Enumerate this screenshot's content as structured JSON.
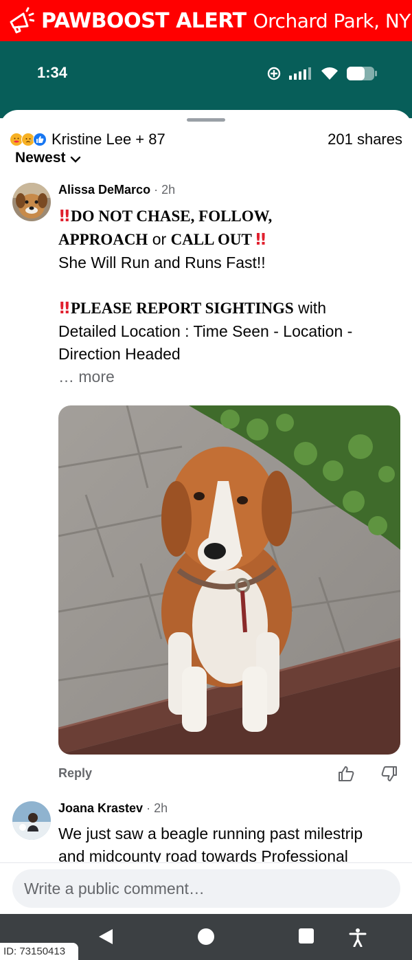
{
  "alert": {
    "title": "PAWBOOST ALERT",
    "location": "Orchard Park, NY",
    "icon": "megaphone-icon"
  },
  "status": {
    "time": "1:34",
    "icons": [
      "target-icon",
      "signal-icon",
      "wifi-icon",
      "battery-icon"
    ]
  },
  "post_meta": {
    "reactions": [
      "care-reaction",
      "sad-reaction",
      "like-reaction"
    ],
    "reactors": "Kristine Lee + 87",
    "shares": "201 shares",
    "sort_label": "Newest"
  },
  "comments": [
    {
      "author": "Alissa DeMarco",
      "time": "· 2h",
      "line1_bold": "DO NOT CHASE, FOLLOW,",
      "line2_bold_a": "APPROACH",
      "line2_mid": " or ",
      "line2_bold_b": "CALL OUT",
      "line3": "She Will Run and Runs Fast!!",
      "line4_bold": "PLEASE REPORT SIGHTINGS",
      "line4_rest": " with",
      "line5": "Detailed Location : Time Seen - Location -",
      "line6": "Direction Headed",
      "more": "… more",
      "reply": "Reply"
    },
    {
      "author": "Joana Krastev",
      "time": "· 2h",
      "line1": "We just saw a beagle running past milestrip",
      "line2": "and midcounty road towards Professional"
    }
  ],
  "composer": {
    "placeholder": "Write a public comment…"
  },
  "nav": [
    "back-icon",
    "home-icon",
    "recents-icon",
    "accessibility-icon"
  ],
  "watermark": "ID: 73150413",
  "colors": {
    "alert_red": "#ff0000",
    "status_teal": "#075e59",
    "muted_text": "#65676b",
    "emphasis_red": "#e0202e"
  }
}
